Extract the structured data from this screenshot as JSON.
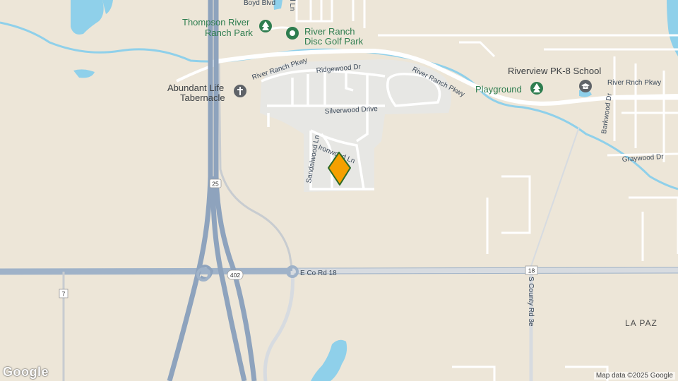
{
  "map": {
    "pois": [
      {
        "name": "Thompson River Ranch Park",
        "line1": "Thompson River",
        "line2": "Ranch Park",
        "icon": "tree-icon",
        "color": "#2e7d4f"
      },
      {
        "name": "River Ranch Disc Golf Park",
        "line1": "River Ranch",
        "line2": "Disc Golf Park",
        "icon": "disc-golf-icon",
        "color": "#2e7d4f"
      },
      {
        "name": "Abundant Life Tabernacle",
        "line1": "Abundant Life",
        "line2": "Tabernacle",
        "icon": "cross-icon",
        "color": "#5f6368"
      },
      {
        "name": "Riverview PK-8 School",
        "line1": "Riverview PK-8 School",
        "icon": "school-icon",
        "color": "#5f6368"
      },
      {
        "name": "Playground",
        "line1": "Playground",
        "icon": "tree-icon",
        "color": "#2e7d4f"
      }
    ],
    "roads": {
      "river_ranch_pkwy": "River Ranch Pkwy",
      "ridgewood": "Ridgewood Dr",
      "silverwood": "Silverwood Drive",
      "sandalwood": "Sandalwood Ln",
      "ironwood": "Ironwood Ln",
      "river_rnch_pkwy": "River Rnch Pkwy",
      "barkwood": "Barkwood Dr",
      "graywood": "Graywood Dr",
      "co_rd_18": "E Co Rd 18",
      "county_rd_3e": "S County Rd 3e",
      "top_blvd": "Boyd Blvd",
      "top_ln": "d Ln"
    },
    "shields": {
      "i25": "25",
      "r402": "402",
      "r7": "7",
      "r18": "18"
    },
    "place": "LA PAZ",
    "marker": {
      "name": "selected-location",
      "color": "#f5a000"
    },
    "attribution": "Map data ©2025 Google",
    "logo": "Google"
  }
}
